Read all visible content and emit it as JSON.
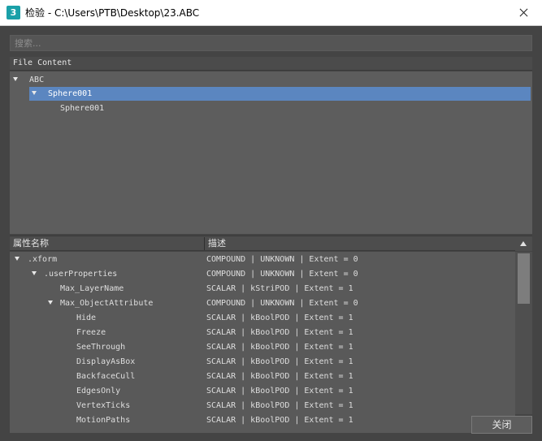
{
  "window": {
    "title": "检验 - C:\\Users\\PTB\\Desktop\\23.ABC",
    "app_icon_text": "3"
  },
  "search": {
    "placeholder": "搜索..."
  },
  "file_content": {
    "header": "File Content",
    "tree": [
      {
        "label": "ABC",
        "expanded": true
      },
      {
        "label": "Sphere001",
        "expanded": true,
        "selected": true
      },
      {
        "label": "Sphere001"
      }
    ]
  },
  "properties": {
    "columns": [
      "属性名称",
      "描述"
    ],
    "rows": [
      {
        "name": ".xform",
        "desc": "COMPOUND | UNKNOWN | Extent = 0",
        "expanded": true
      },
      {
        "name": ".userProperties",
        "desc": "COMPOUND | UNKNOWN | Extent = 0",
        "expanded": true
      },
      {
        "name": "Max_LayerName",
        "desc": "SCALAR | kStriPOD | Extent = 1"
      },
      {
        "name": "Max_ObjectAttribute",
        "desc": "COMPOUND | UNKNOWN | Extent = 0",
        "expanded": true
      },
      {
        "name": "Hide",
        "desc": "SCALAR | kBoolPOD | Extent = 1"
      },
      {
        "name": "Freeze",
        "desc": "SCALAR | kBoolPOD | Extent = 1"
      },
      {
        "name": "SeeThrough",
        "desc": "SCALAR | kBoolPOD | Extent = 1"
      },
      {
        "name": "DisplayAsBox",
        "desc": "SCALAR | kBoolPOD | Extent = 1"
      },
      {
        "name": "BackfaceCull",
        "desc": "SCALAR | kBoolPOD | Extent = 1"
      },
      {
        "name": "EdgesOnly",
        "desc": "SCALAR | kBoolPOD | Extent = 1"
      },
      {
        "name": "VertexTicks",
        "desc": "SCALAR | kBoolPOD | Extent = 1"
      },
      {
        "name": "MotionPaths",
        "desc": "SCALAR | kBoolPOD | Extent = 1"
      }
    ]
  },
  "buttons": {
    "close": "关闭"
  },
  "colors": {
    "selection": "#5b86c0",
    "background": "#444444",
    "panel": "#5d5d5d"
  }
}
